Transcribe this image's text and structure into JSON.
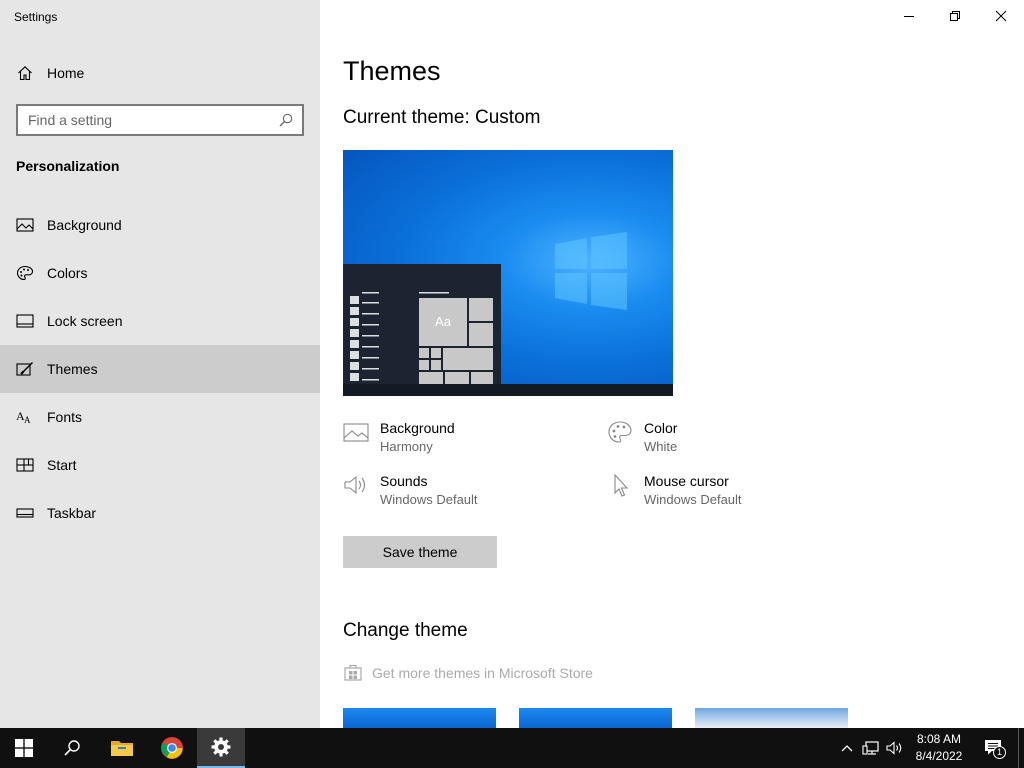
{
  "window": {
    "title": "Settings",
    "minimize": "—",
    "restore": "❐",
    "close": "✕"
  },
  "sidebar": {
    "home_label": "Home",
    "search_placeholder": "Find a setting",
    "section_label": "Personalization",
    "items": [
      {
        "label": "Background",
        "icon": "picture-icon"
      },
      {
        "label": "Colors",
        "icon": "palette-icon"
      },
      {
        "label": "Lock screen",
        "icon": "lock-screen-icon"
      },
      {
        "label": "Themes",
        "icon": "paintbrush-icon",
        "selected": true
      },
      {
        "label": "Fonts",
        "icon": "font-icon"
      },
      {
        "label": "Start",
        "icon": "start-icon"
      },
      {
        "label": "Taskbar",
        "icon": "taskbar-icon"
      }
    ]
  },
  "main": {
    "title": "Themes",
    "current_theme_label": "Current theme: Custom",
    "preview_tile_text": "Aa",
    "properties": [
      {
        "name": "Background",
        "value": "Harmony",
        "icon": "picture-icon"
      },
      {
        "name": "Color",
        "value": "White",
        "icon": "palette-icon"
      },
      {
        "name": "Sounds",
        "value": "Windows Default",
        "icon": "speaker-icon"
      },
      {
        "name": "Mouse cursor",
        "value": "Windows Default",
        "icon": "cursor-icon"
      }
    ],
    "save_button": "Save theme",
    "change_theme_label": "Change theme",
    "store_link": "Get more themes in Microsoft Store"
  },
  "taskbar": {
    "time": "8:08 AM",
    "date": "8/4/2022",
    "notification_count": "1",
    "apps": [
      "start-icon",
      "search-icon",
      "file-explorer-icon",
      "chrome-icon",
      "settings-icon"
    ]
  },
  "colors": {
    "sidebar_bg": "#e6e6e6",
    "selected_bg": "#cccccc",
    "taskbar_bg": "#101010",
    "accent": "#0078d7"
  }
}
